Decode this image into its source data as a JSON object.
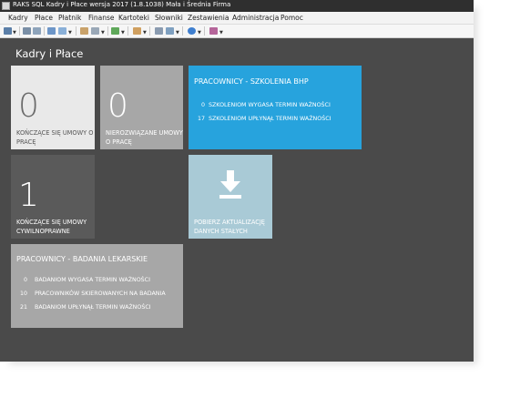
{
  "window": {
    "title": "RAKS SQL Kadry i Płace wersja 2017 (1.8.1038) Mała i Średnia Firma"
  },
  "menu": [
    "Kadry",
    "Płace",
    "Płatnik",
    "Finanse",
    "Kartoteki",
    "Słowniki",
    "Zestawienia",
    "Administracja",
    "Pomoc"
  ],
  "page": {
    "title": "Kadry i Płace"
  },
  "tiles": {
    "ending_contracts": {
      "count": "0",
      "label": "KOŃCZĄCE SIĘ UMOWY O PRACĘ"
    },
    "unsettled_contracts": {
      "count": "0",
      "label": "NIEROZWIĄZANE UMOWY O PRACĘ"
    },
    "civil_contracts": {
      "count": "1",
      "label": "KOŃCZĄCE SIĘ UMOWY CYWILNOPRAWNE"
    },
    "update": {
      "label": "POBIERZ AKTUALIZACJĘ DANYCH STAŁYCH"
    }
  },
  "bhp": {
    "title": "PRACOWNICY - SZKOLENIA BHP",
    "rows": [
      {
        "count": "0",
        "text": "SZKOLENIOM WYGASA TERMIN WAŻNOŚCI"
      },
      {
        "count": "17",
        "text": "SZKOLENIOM UPŁYNĄŁ TERMIN WAŻNOŚCI"
      }
    ]
  },
  "medical": {
    "title": "PRACOWNICY - BADANIA LEKARSKIE",
    "rows": [
      {
        "count": "0",
        "text": "BADANIOM WYGASA TERMIN WAŻNOŚCI"
      },
      {
        "count": "10",
        "text": "PRACOWNIKÓW SKIEROWANYCH NA BADANIA"
      },
      {
        "count": "21",
        "text": "BADANIOM UPŁYNĄŁ TERMIN WAŻNOŚCI"
      }
    ]
  },
  "colors": {
    "background": "#4a4a4a",
    "tile_light": "#e9e9e9",
    "tile_gray": "#a7a7a7",
    "tile_dark": "#5a5a5a",
    "tile_blue": "#27a3dd",
    "tile_lightblue": "#a9cad6"
  }
}
